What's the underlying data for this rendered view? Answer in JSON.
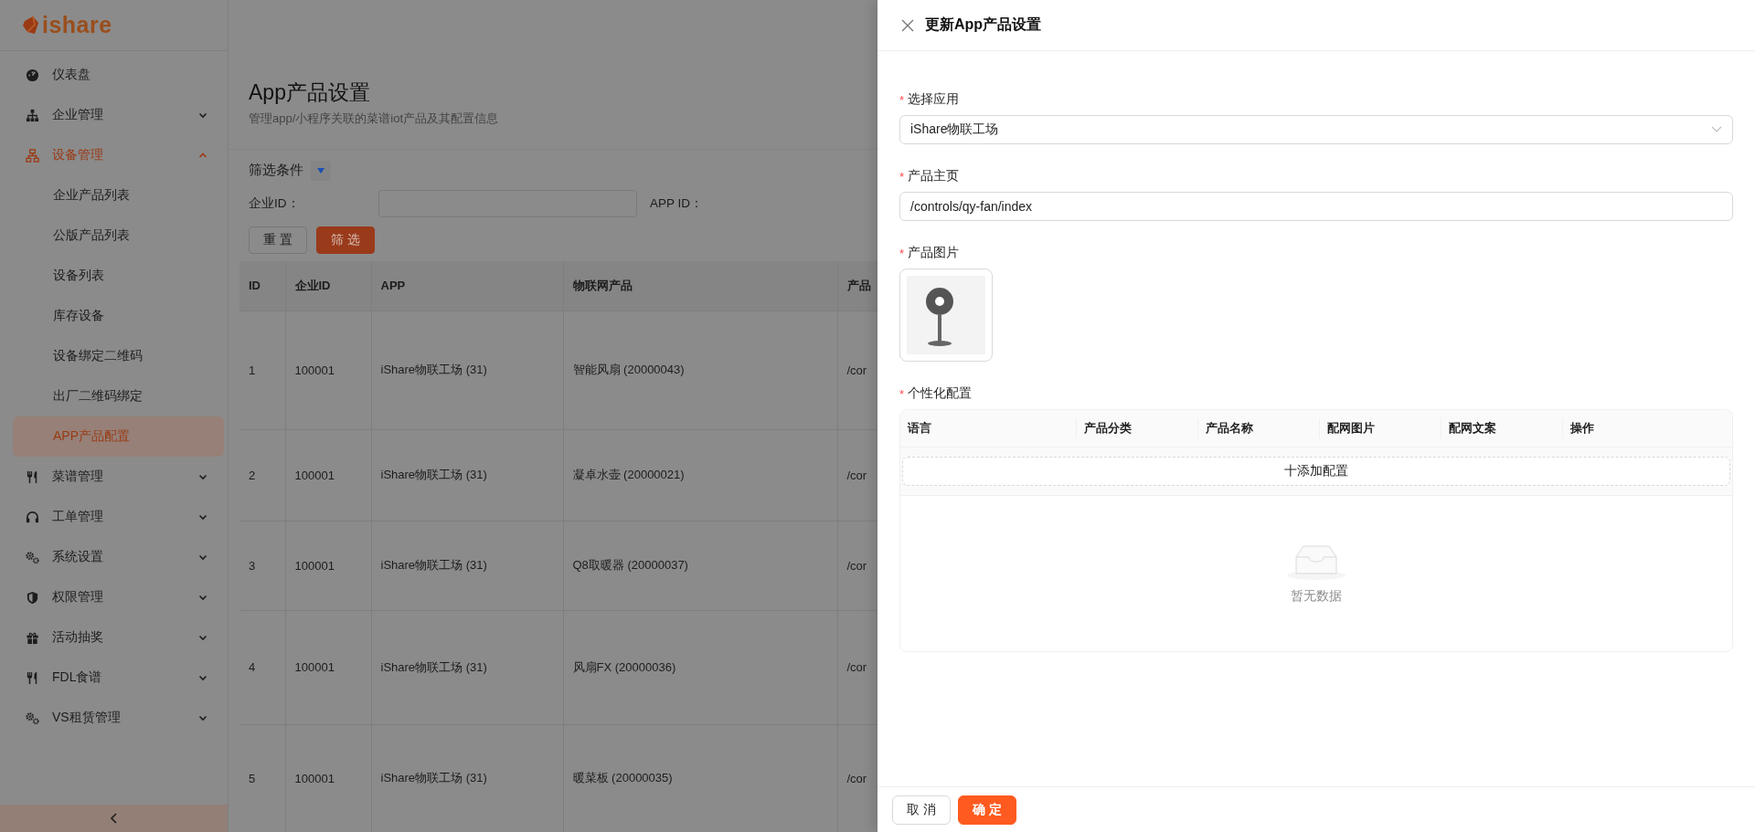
{
  "sidebar": {
    "logo": "ishare",
    "items": [
      {
        "label": "仪表盘"
      },
      {
        "label": "企业管理",
        "expanded": false
      },
      {
        "label": "设备管理",
        "expanded": true,
        "children": [
          {
            "label": "企业产品列表",
            "selected": false
          },
          {
            "label": "公版产品列表",
            "selected": false
          },
          {
            "label": "设备列表",
            "selected": false
          },
          {
            "label": "库存设备",
            "selected": false
          },
          {
            "label": "设备绑定二维码",
            "selected": false
          },
          {
            "label": "出厂二维码绑定",
            "selected": false
          },
          {
            "label": "APP产品配置",
            "selected": true
          }
        ]
      },
      {
        "label": "菜谱管理",
        "expanded": false
      },
      {
        "label": "工单管理",
        "expanded": false
      },
      {
        "label": "系统设置",
        "expanded": false
      },
      {
        "label": "权限管理",
        "expanded": false
      },
      {
        "label": "活动抽奖",
        "expanded": false
      },
      {
        "label": "FDL食谱",
        "expanded": false
      },
      {
        "label": "VS租赁管理",
        "expanded": false
      }
    ]
  },
  "page": {
    "title": "App产品设置",
    "subtitle": "管理app/小程序关联的菜谱iot产品及其配置信息"
  },
  "filter": {
    "label": "筛选条件",
    "expanded": false,
    "fields": [
      {
        "label": "企业ID："
      },
      {
        "label": "APP ID："
      }
    ],
    "buttons": [
      {
        "label": "重 置",
        "kind": "default"
      },
      {
        "label": "筛 选",
        "kind": "primary"
      }
    ]
  },
  "table": {
    "columns": [
      "ID",
      "企业ID",
      "APP",
      "物联网产品",
      "产品"
    ],
    "rows": [
      {
        "id": "1",
        "company_id": "100001",
        "app": "iShare物联工场 (31)",
        "product": "智能风扇 (20000043)",
        "column_5": "/cor"
      },
      {
        "id": "2",
        "company_id": "100001",
        "app": "iShare物联工场 (31)",
        "product": "凝卓水壶 (20000021)",
        "column_5": "/cor"
      },
      {
        "id": "3",
        "company_id": "100001",
        "app": "iShare物联工场 (31)",
        "product": "Q8取暖器 (20000037)",
        "column_5": "/cor"
      },
      {
        "id": "4",
        "company_id": "100001",
        "app": "iShare物联工场 (31)",
        "product": "风扇FX (20000036)",
        "column_5": "/cor"
      },
      {
        "id": "5",
        "company_id": "100001",
        "app": "iShare物联工场 (31)",
        "product": "暖菜板 (20000035)",
        "column_5": "/cor"
      }
    ]
  },
  "drawer": {
    "title": "更新App产品设置",
    "fields": [
      {
        "kind": "select",
        "label": "选择应用",
        "required_mark": "*",
        "value": "iShare物联工场"
      },
      {
        "kind": "input",
        "label": "产品主页",
        "required_mark": "*",
        "value": "/controls/qy-fan/index"
      },
      {
        "kind": "image",
        "label": "产品图片",
        "required_mark": "*"
      },
      {
        "kind": "table",
        "label": "个性化配置",
        "required_mark": "*",
        "columns": [
          "语言",
          "产品分类",
          "产品名称",
          "配网图片",
          "配网文案",
          "操作"
        ],
        "add_button": "十添加配置",
        "empty_text": "暂无数据"
      }
    ],
    "buttons": [
      {
        "label": "取 消",
        "kind": "default"
      },
      {
        "label": "确 定",
        "kind": "primary"
      }
    ]
  }
}
